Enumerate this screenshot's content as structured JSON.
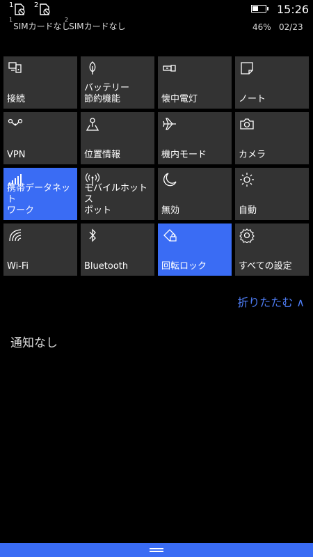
{
  "status_bar": {
    "sim1_num": "1",
    "sim2_num": "2",
    "sim1_label": "SIMカードなし",
    "sim2_label": "SIMカードなし",
    "time": "15:26",
    "battery_percent": "46%",
    "battery_level": 0.46,
    "date": "02/23"
  },
  "tiles": [
    {
      "label": "接続",
      "icon": "connect-icon",
      "active": false
    },
    {
      "label": "バッテリー\n節約機能",
      "icon": "battery-saver-icon",
      "active": false
    },
    {
      "label": "懐中電灯",
      "icon": "flashlight-icon",
      "active": false
    },
    {
      "label": "ノート",
      "icon": "note-icon",
      "active": false
    },
    {
      "label": "VPN",
      "icon": "vpn-icon",
      "active": false
    },
    {
      "label": "位置情報",
      "icon": "location-icon",
      "active": false
    },
    {
      "label": "機内モード",
      "icon": "airplane-icon",
      "active": false
    },
    {
      "label": "カメラ",
      "icon": "camera-icon",
      "active": false
    },
    {
      "label": "携帯データネット\nワーク",
      "icon": "cellular-icon",
      "active": true
    },
    {
      "label": "モバイルホットス\nポット",
      "icon": "hotspot-icon",
      "active": false
    },
    {
      "label": "無効",
      "icon": "moon-icon",
      "active": false
    },
    {
      "label": "自動",
      "icon": "brightness-icon",
      "active": false
    },
    {
      "label": "Wi-Fi",
      "icon": "wifi-icon",
      "active": false
    },
    {
      "label": "Bluetooth",
      "icon": "bluetooth-icon",
      "active": false
    },
    {
      "label": "回転ロック",
      "icon": "rotation-lock-icon",
      "active": true
    },
    {
      "label": "すべての設定",
      "icon": "settings-icon",
      "active": false
    }
  ],
  "collapse_label": "折りたたむ ∧",
  "notifications_empty": "通知なし",
  "colors": {
    "accent": "#3a6cf4",
    "tile": "#333333",
    "link": "#4e7df5"
  }
}
